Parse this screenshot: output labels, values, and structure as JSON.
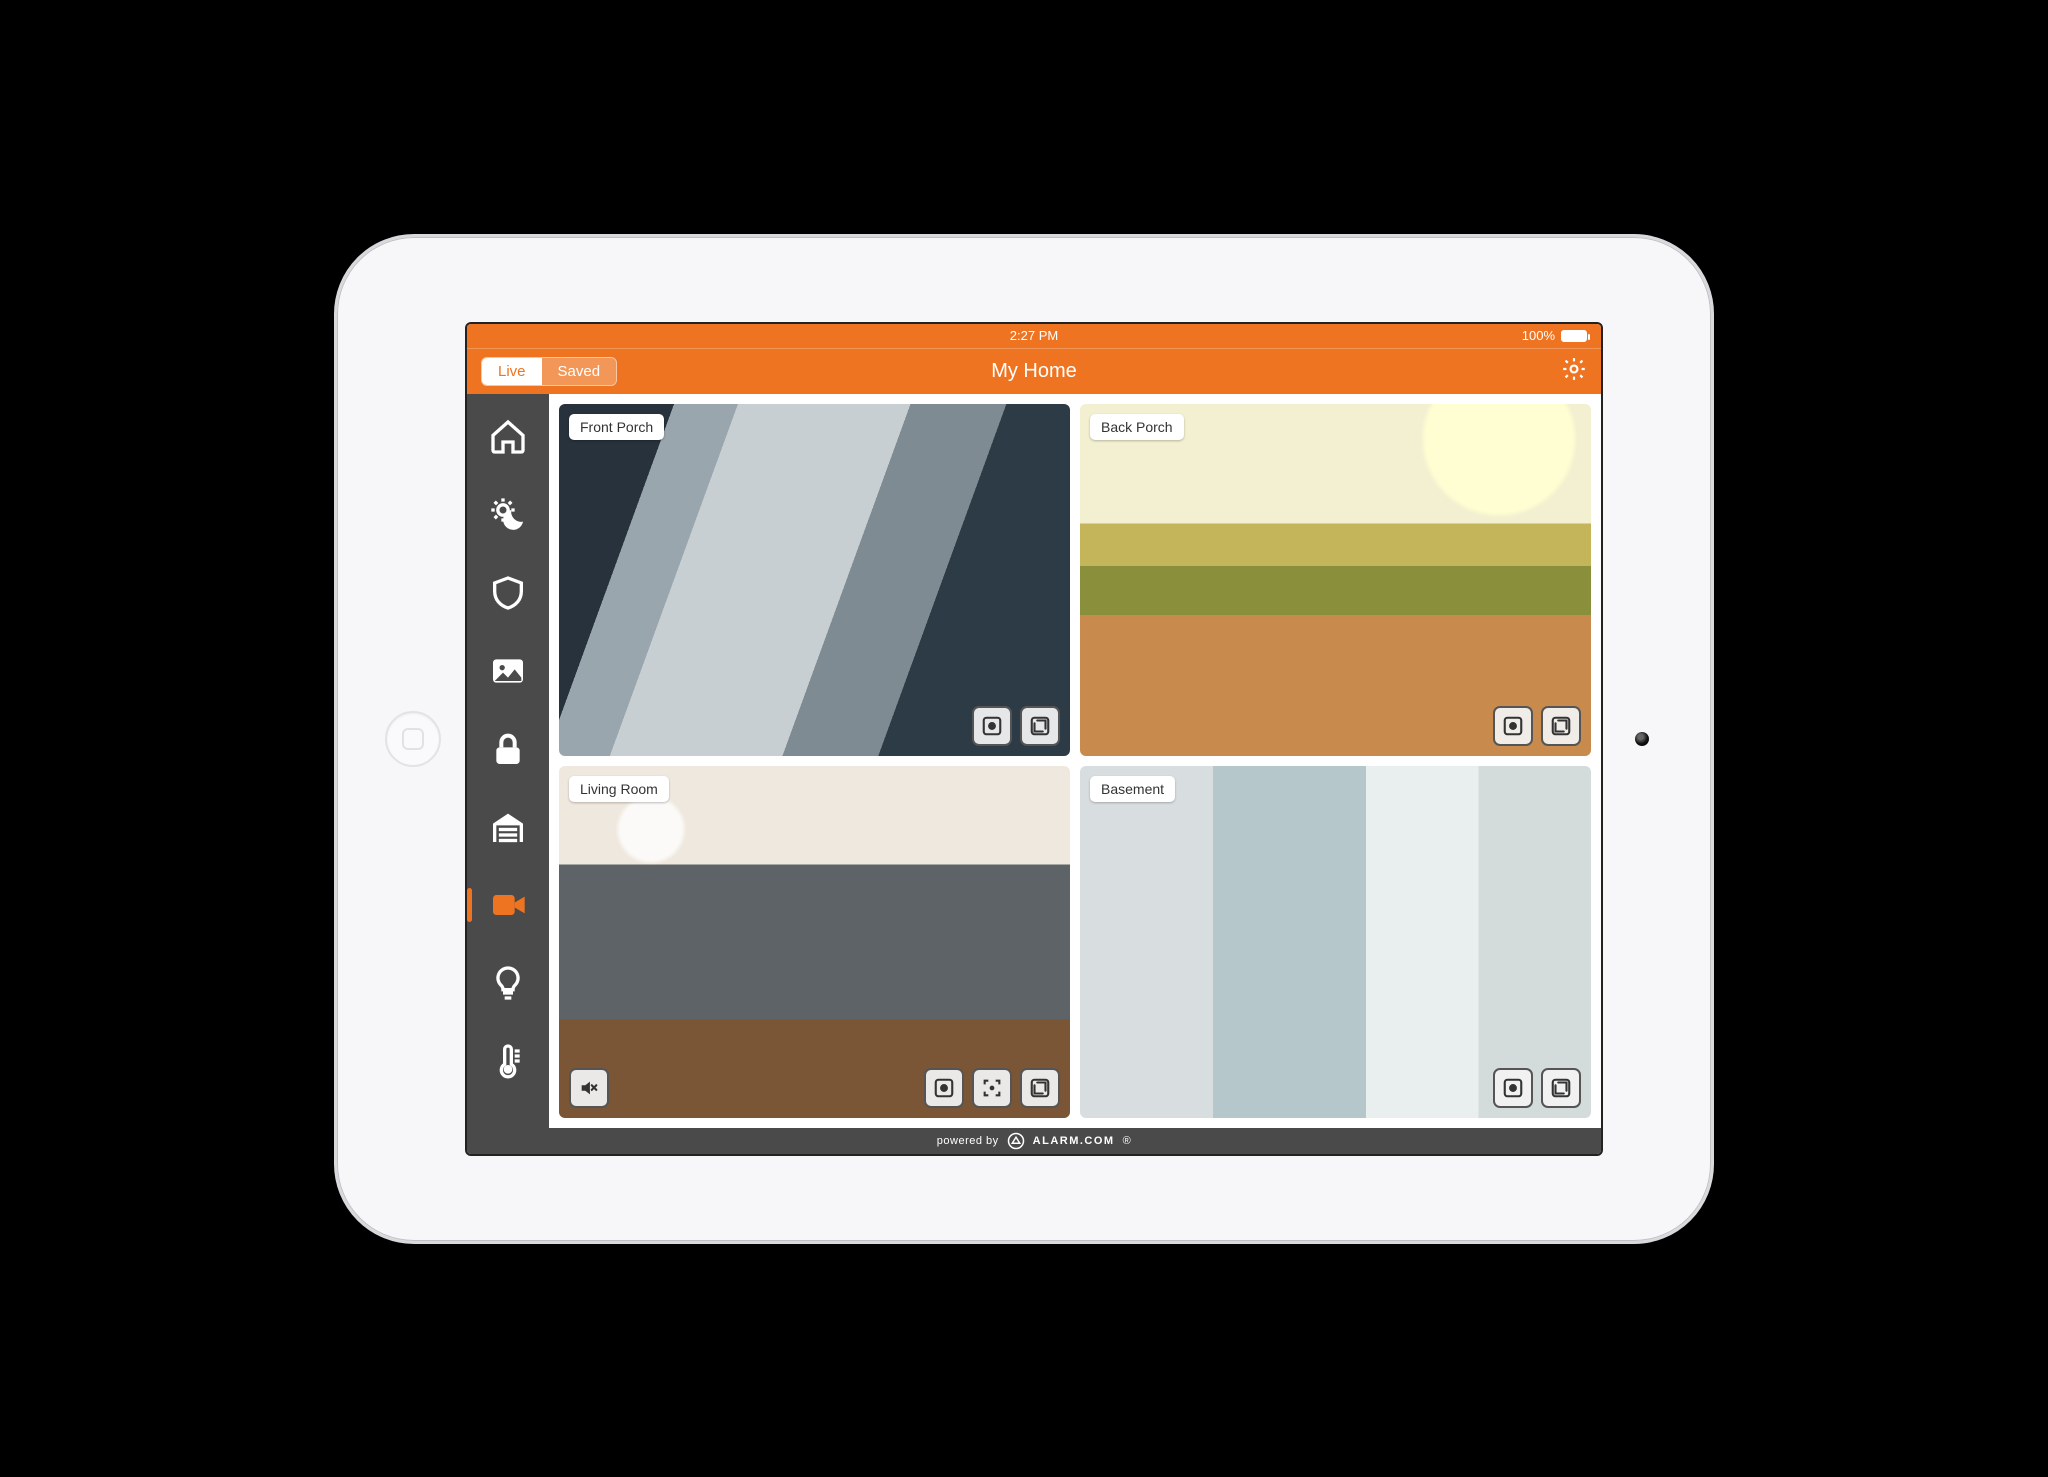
{
  "colors": {
    "accent": "#ee7421",
    "sidebar": "#4a4a4a"
  },
  "status": {
    "time": "2:27 PM",
    "battery_text": "100%"
  },
  "header": {
    "tabs": {
      "live": "Live",
      "saved": "Saved",
      "active": "live"
    },
    "title": "My Home"
  },
  "sidebar": {
    "items": [
      {
        "id": "home",
        "icon": "home-icon"
      },
      {
        "id": "scenes",
        "icon": "sun-moon-icon"
      },
      {
        "id": "security",
        "icon": "shield-icon"
      },
      {
        "id": "images",
        "icon": "image-icon"
      },
      {
        "id": "locks",
        "icon": "lock-icon"
      },
      {
        "id": "garage",
        "icon": "garage-icon"
      },
      {
        "id": "video",
        "icon": "video-icon",
        "active": true
      },
      {
        "id": "lights",
        "icon": "lightbulb-icon"
      },
      {
        "id": "thermostat",
        "icon": "thermostat-icon"
      }
    ]
  },
  "cameras": [
    {
      "id": "front-porch",
      "label": "Front Porch",
      "has_mute": false,
      "has_focus": false
    },
    {
      "id": "back-porch",
      "label": "Back Porch",
      "has_mute": false,
      "has_focus": false
    },
    {
      "id": "living-room",
      "label": "Living Room",
      "has_mute": true,
      "has_focus": true
    },
    {
      "id": "basement",
      "label": "Basement",
      "has_mute": false,
      "has_focus": false
    }
  ],
  "footer": {
    "powered_by": "powered by",
    "brand": "ALARM.COM"
  }
}
